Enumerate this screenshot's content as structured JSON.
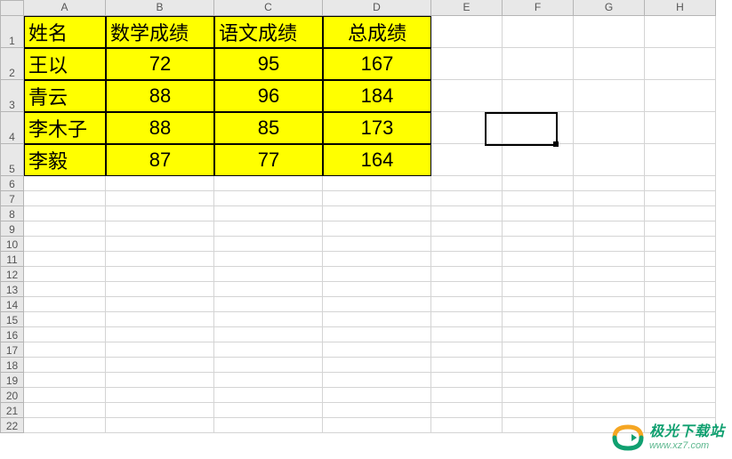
{
  "columns": [
    "A",
    "B",
    "C",
    "D",
    "E",
    "F",
    "G",
    "H"
  ],
  "rows": [
    1,
    2,
    3,
    4,
    5,
    6,
    7,
    8,
    9,
    10,
    11,
    12,
    13,
    14,
    15,
    16,
    17,
    18,
    19,
    20,
    21,
    22
  ],
  "table": {
    "headers": [
      "姓名",
      "数学成绩",
      "语文成绩",
      "总成绩"
    ],
    "data": [
      {
        "name": "王以",
        "math": 72,
        "chinese": 95,
        "total": 167
      },
      {
        "name": "青云",
        "math": 88,
        "chinese": 96,
        "total": 184
      },
      {
        "name": "李木子",
        "math": 88,
        "chinese": 85,
        "total": 173
      },
      {
        "name": "李毅",
        "math": 87,
        "chinese": 77,
        "total": 164
      }
    ]
  },
  "selected_cell": "F4",
  "watermark": {
    "title": "极光下载站",
    "url": "www.xz7.com"
  },
  "chart_data": {
    "type": "table",
    "title": "",
    "columns": [
      "姓名",
      "数学成绩",
      "语文成绩",
      "总成绩"
    ],
    "rows": [
      [
        "王以",
        72,
        95,
        167
      ],
      [
        "青云",
        88,
        96,
        184
      ],
      [
        "李木子",
        88,
        85,
        173
      ],
      [
        "李毅",
        87,
        77,
        164
      ]
    ]
  }
}
